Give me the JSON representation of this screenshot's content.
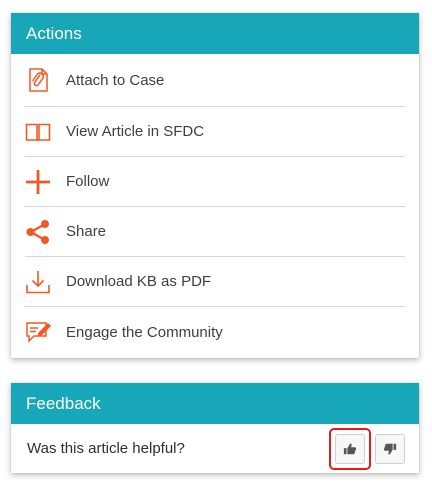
{
  "actions": {
    "title": "Actions",
    "items": [
      {
        "label": "Attach to Case",
        "icon": "paperclip-document-icon"
      },
      {
        "label": "View Article in SFDC",
        "icon": "open-book-icon"
      },
      {
        "label": "Follow",
        "icon": "plus-icon"
      },
      {
        "label": "Share",
        "icon": "share-icon"
      },
      {
        "label": "Download KB as PDF",
        "icon": "download-icon"
      },
      {
        "label": "Engage the Community",
        "icon": "community-chat-icon"
      }
    ]
  },
  "feedback": {
    "title": "Feedback",
    "question": "Was this article helpful?",
    "buttons": [
      {
        "icon": "thumbs-up-icon"
      },
      {
        "icon": "thumbs-down-icon"
      }
    ]
  },
  "colors": {
    "header_bg": "#17a7b8",
    "icon_accent": "#f05a22",
    "highlight": "#e31b1b"
  }
}
